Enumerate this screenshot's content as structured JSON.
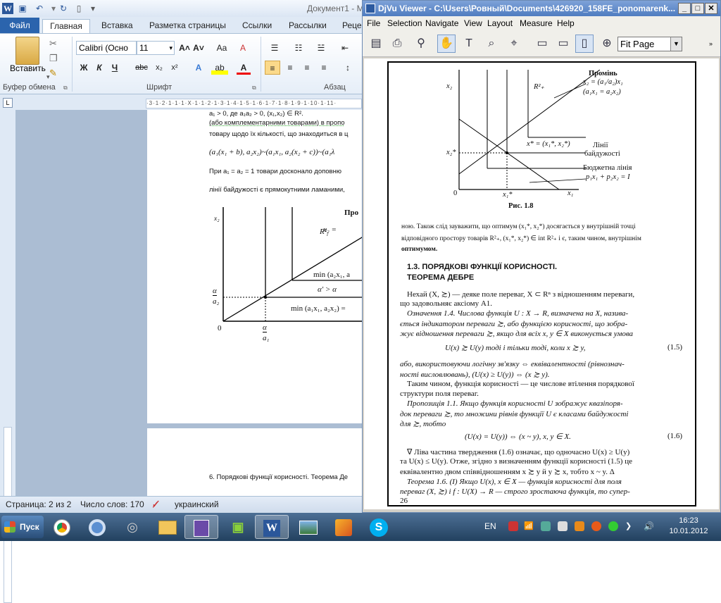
{
  "word": {
    "title": "Документ1 - М",
    "tabs": [
      "Файл",
      "Главная",
      "Вставка",
      "Разметка страницы",
      "Ссылки",
      "Рассылки",
      "Реце"
    ],
    "ribbon": {
      "paste_label": "Вставить",
      "clipboard_label": "Буфер обмена",
      "font_label": "Шрифт",
      "paragraph_label": "Абзац",
      "font_name": "Calibri (Осно",
      "font_size": "11",
      "bold": "Ж",
      "italic": "К",
      "underline": "Ч",
      "strike": "abc",
      "subscript": "x₂",
      "superscript": "x²",
      "grow": "A˄",
      "shrink": "A˅",
      "case": "Aa",
      "clear_fmt": "A"
    },
    "document": {
      "line1": "a₁ > 0, де a₁a₂ > 0, (x₁,x₂) ∈ R².",
      "line2": "(або комплементарними товарами) в пропо",
      "line3": "товару щодо їх кількості, що знаходиться в ц",
      "line4": "(a₁(x₁ + b), a₂x₂)~(a₁x₁, a₂(x₂ + c))~(a₁λ",
      "line5": "При a₁ = a₂ = 1 товари досконало доповню",
      "line6": "лінії байдужості є прямокутними ламаними,",
      "page2_line": "6. Порядкові функції корисності. Теорема Де",
      "chart_prom": "Про",
      "chart_x2": "x₂",
      "chart_rr": "R²",
      "chart_rr_sub": "i",
      "chart_x2eq": "x₂ =",
      "chart_min1": "min (a₂x₁, a",
      "chart_alpha": "α′ > α",
      "chart_min2": "min (a₁x₁, a₂x₂) =",
      "chart_alpha_num": "α",
      "chart_alpha_den": "a₂",
      "chart_zero": "0",
      "chart_xa_num": "α",
      "chart_xa_den": "a₁"
    },
    "status": {
      "page": "Страница: 2 из 2",
      "words": "Число слов: 170",
      "language": "украинский"
    }
  },
  "djvu": {
    "title": "DjVu Viewer - C:\\Users\\Ровный\\Documents\\426920_158FE_ponomarenk...",
    "menu": [
      "File",
      "Selection",
      "Navigate",
      "View",
      "Layout",
      "Measure",
      "Help"
    ],
    "zoom": "Fit Page",
    "page": {
      "fig_prom": "Промінь",
      "fig_ray": "x₂ = (a₁/a₂)x₁",
      "fig_ray2": "(a₁x₁ = a₂x₂)",
      "fig_x2": "x₂",
      "fig_rplus": "R²₊",
      "fig_opt": "x* = (x₁*, x₂*)",
      "fig_indiff": "Лінії",
      "fig_indiff2": "байдужості",
      "fig_budget": "Бюджетна лінія",
      "fig_budget_eq": "p₁x₁ + p₂x₂ = I",
      "fig_x2star": "x₂*",
      "fig_zero": "0",
      "fig_x1star": "x₁*",
      "fig_x1": "x₁",
      "fig_caption": "Рис. 1.8",
      "p1": "ною. Також слід зауважити, що оптимум (x₁*, x₂*) досягається у внутрішній точці",
      "p2": "відповідного простору товарів R²₊, (x₁*, x₂*) ∈ int R²₊ і є, таким чином, внутрішнім",
      "p3": "оптимумом.",
      "h1": "1.3. ПОРЯДКОВІ ФУНКЦІЇ КОРИСНОСТІ.",
      "h2": "ТЕОРЕМА ДЕБРЕ",
      "t1": "Нехай (X, ≿) — деяке поле переваг, X ⊂ Rⁿ з відношенням переваги,",
      "t2": "що задовольняє аксіому A1.",
      "d1": "Означення 1.4. Числова функція U : X → R, визначена на X, назива-",
      "d2": "ється індикатором переваги ≿, або функцією корисності, що зобра-",
      "d3": "жує відношення переваги ≿, якщо для всіх x, y ∈ X виконується умова",
      "f1": "U(x) ≿ U(y) тоді і тільки тоді, коли x ≿ y,",
      "f1n": "(1.5)",
      "a1": "або, використовуючи логічну зв'язку ⇔ еквівалентності (рівнознач-",
      "a2": "ності висловлювань), (U(x) ≥ U(y)) ⇔ (x ≿ y).",
      "s1": "Таким чином, функція корисності — це числове втілення порядкової",
      "s2": "структури поля переваг.",
      "pr1": "Пропозиція 1.1. Якщо функція корисності U зображує квазіпоря-",
      "pr2": "док переваги ≿, то множини рівнів функції U є класами байдужості",
      "pr3": "для ≿, тобто",
      "f2": "(U(x) = U(y)) ⇔ (x ~ y),  x, y ∈ X.",
      "f2n": "(1.6)",
      "e1": "∇ Ліва частина твердження (1.6) означає, що одночасно U(x) ≥ U(y)",
      "e2": "та U(x) ≤ U(y). Отже, згідно з визначенням функції корисності (1.5) це",
      "e3": "еквівалентно двом співвідношенням x ≿ y й y ≿ x, тобто x ~ y. Δ",
      "th1": "Теорема 1.6. (I) Якщо U(x), x ∈ X — функція корисності для поля",
      "th2": "переваг (X, ≿) і f : U(X) → R — строго зростаюча функція, то супер-",
      "pagenum": "26"
    }
  },
  "taskbar": {
    "start": "Пуск",
    "lang": "EN",
    "time": "16:23",
    "date": "10.01.2012"
  }
}
